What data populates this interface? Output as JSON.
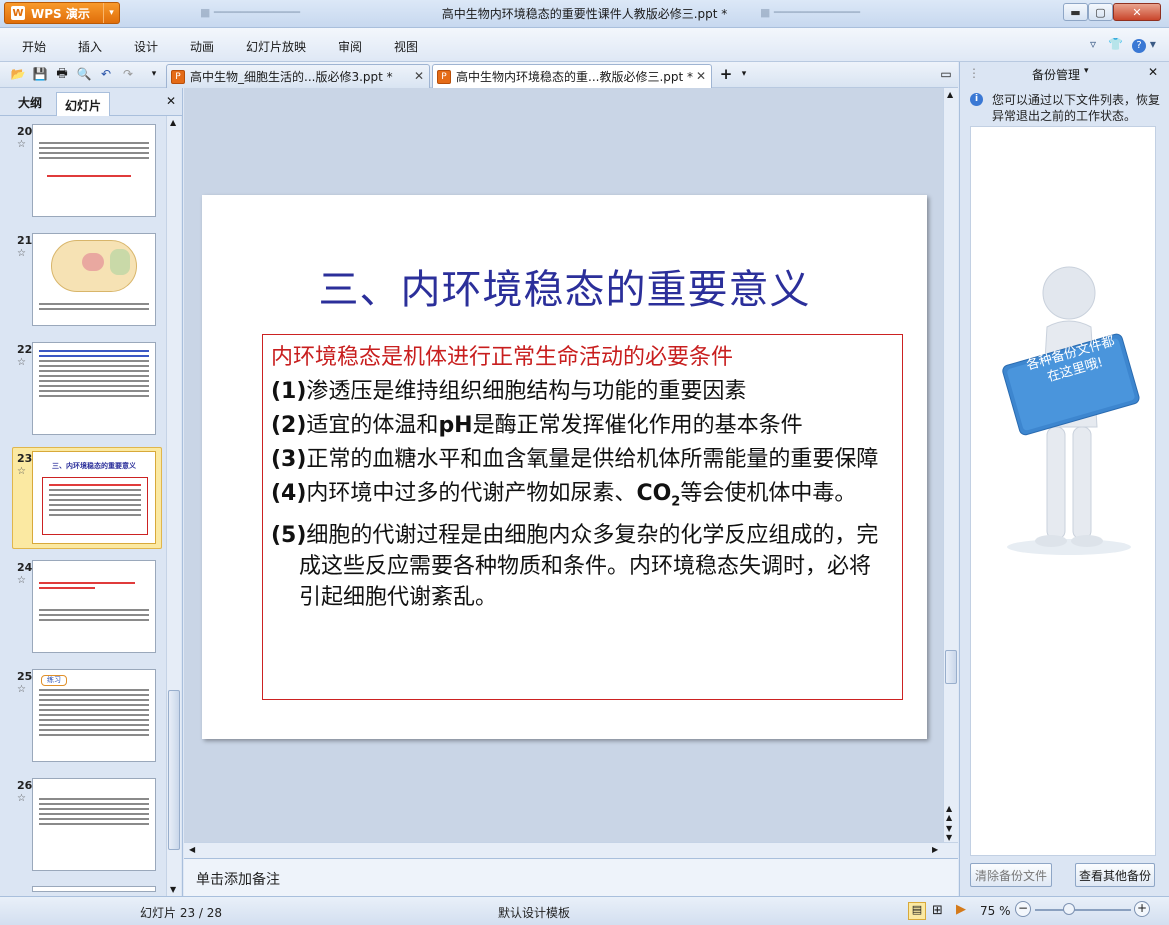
{
  "window": {
    "app_button": "WPS 演示",
    "title": "高中生物内环境稳态的重要性课件人教版必修三.ppt *"
  },
  "menu": {
    "items": [
      "开始",
      "插入",
      "设计",
      "动画",
      "幻灯片放映",
      "审阅",
      "视图"
    ]
  },
  "doc_tabs": [
    {
      "label": "高中生物_细胞生活的...版必修3.ppt *",
      "active": false
    },
    {
      "label": "高中生物内环境稳态的重...教版必修三.ppt *",
      "active": true
    }
  ],
  "left_panel": {
    "tabs": [
      "大纲",
      "幻灯片"
    ],
    "active_tab": "幻灯片",
    "slides": [
      {
        "num": "20"
      },
      {
        "num": "21"
      },
      {
        "num": "22"
      },
      {
        "num": "23"
      },
      {
        "num": "24"
      },
      {
        "num": "25"
      },
      {
        "num": "26"
      }
    ],
    "selected": "23",
    "thumb23_title": "三、内环境稳态的重要意义",
    "thumb25_label": "练习"
  },
  "slide": {
    "title": "三、内环境稳态的重要意义",
    "box_head": "内环境稳态是机体进行正常生命活动的必要条件",
    "items": [
      {
        "n": "(1)",
        "text": "渗透压是维持组织细胞结构与功能的重要因素"
      },
      {
        "n": "(2)",
        "text_a": "适宜的体温和",
        "ph": "pH",
        "text_b": "是酶正常发挥催化作用的基本条件"
      },
      {
        "n": "(3)",
        "text": "正常的血糖水平和血含氧量是供给机体所需能量的重要保障"
      },
      {
        "n": "(4)",
        "text_a": "内环境中过多的代谢产物如尿素、",
        "co": "CO",
        "sub": "2",
        "text_b": "等会使机体中毒。"
      },
      {
        "n": "(5)",
        "text": "细胞的代谢过程是由细胞内众多复杂的化学反应组成的，完成这些反应需要各种物质和条件。内环境稳态失调时，必将引起细胞代谢紊乱。"
      }
    ]
  },
  "notes": {
    "placeholder": "单击添加备注"
  },
  "right_panel": {
    "title": "备份管理",
    "info": "您可以通过以下文件列表，恢复异常退出之前的工作状态。",
    "sign_text": "各种备份文件都在这里哦!",
    "btn_clear": "清除备份文件",
    "btn_other": "查看其他备份"
  },
  "status": {
    "slide_pos": "幻灯片 23 / 28",
    "template": "默认设计模板",
    "zoom": "75 %"
  }
}
